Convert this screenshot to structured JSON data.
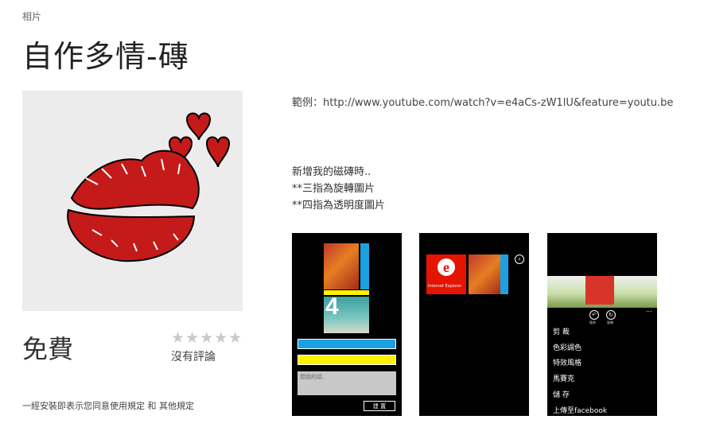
{
  "app": {
    "category": "相片",
    "title": "自作多情-磚",
    "price": "免費",
    "rating_stars": "★★★★★",
    "rating_text": "沒有評論",
    "terms_prefix": "一經安裝即表示您同意",
    "terms_link1": "使用規定",
    "terms_and": " 和 ",
    "terms_link2": "其他規定"
  },
  "description": {
    "example": "範例：http://www.youtube.com/watch?v=e4aCs-zW1lU&feature=youtu.be",
    "line1": "新增我的磁磚時..",
    "line2": "**三指為旋轉圖片",
    "line3": "**四指為透明度圖片"
  },
  "screenshots": {
    "s1": {
      "textbox_placeholder": "想說的話..",
      "button_label": "建 置"
    },
    "s2": {
      "tile_label": "Internet Explorer"
    },
    "s3": {
      "label_undo": "復原",
      "label_rotate": "旋轉",
      "more": "...",
      "menu": [
        "剪 裁",
        "色彩調色",
        "特效風格",
        "馬賽克",
        "儲 存",
        "上傳至facebook"
      ]
    }
  },
  "colors": {
    "lips": "#c41a1a",
    "tile_blue": "#1ba1e2",
    "tile_yellow": "#fff200",
    "ie_red": "#e51400"
  }
}
